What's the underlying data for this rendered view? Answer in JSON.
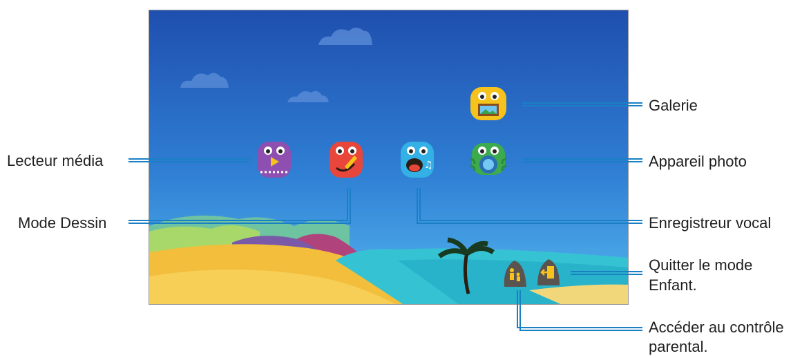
{
  "callouts": {
    "gallery": "Galerie",
    "camera": "Appareil photo",
    "media_player": "Lecteur média",
    "drawing_mode": "Mode Dessin",
    "voice_recorder": "Enregistreur vocal",
    "exit_line1": "Quitter le mode",
    "exit_line2": "Enfant.",
    "parental_line1": "Accéder au contrôle",
    "parental_line2": "parental."
  },
  "apps": [
    {
      "name": "Galerie",
      "icon": "gallery-icon",
      "color": "#f6c21c"
    },
    {
      "name": "Appareil photo",
      "icon": "camera-icon",
      "color": "#3cab4e"
    },
    {
      "name": "Lecteur média",
      "icon": "media-player-icon",
      "color": "#8e4fb0"
    },
    {
      "name": "Mode Dessin",
      "icon": "drawing-mode-icon",
      "color": "#e8463a"
    },
    {
      "name": "Enregistreur vocal",
      "icon": "voice-recorder-icon",
      "color": "#33b0e6"
    }
  ],
  "colors": {
    "sky_top": "#1f4fae",
    "sky_bottom": "#46a6ea",
    "sand": "#f2be3c",
    "sea": "#35c3d4",
    "leader_line": "#1b7fc4"
  }
}
